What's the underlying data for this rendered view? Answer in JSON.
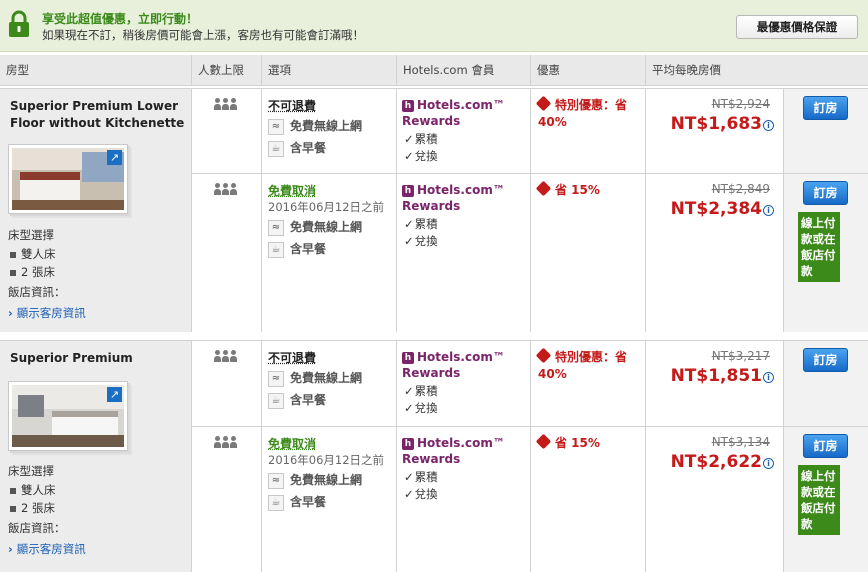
{
  "banner": {
    "title": "享受此超值優惠，立即行動！",
    "subtitle": "如果現在不訂，稍後房價可能會上漲，客房也有可能會訂滿哦！",
    "guarantee_label": "最優惠價格保證"
  },
  "table_headers": [
    "房型",
    "人數上限",
    "選項",
    "Hotels.com 會員",
    "優惠",
    "平均每晚房價"
  ],
  "labels": {
    "bed_choice": "床型選擇",
    "hotel_info": "飯店資訊：",
    "show_room_info": "顯示客房資訊",
    "book": "訂房",
    "pay_note": "線上付款或在飯店付款",
    "rewards_brand": "Hotels.com™ Rewards",
    "collect": "累積",
    "redeem": "兌換",
    "wifi": "免費無線上網",
    "breakfast": "含早餐"
  },
  "rooms": [
    {
      "name": "Superior Premium Lower Floor without Kitchenette",
      "beds": [
        "雙人床",
        "2 張床"
      ],
      "rates": [
        {
          "option": "不可退費",
          "option_date": "",
          "deal": "特別優惠：省 40%",
          "old_price": "NT$2,924",
          "price": "NT$1,683",
          "pay_note": false
        },
        {
          "option": "免費取消",
          "option_date": "2016年06月12日之前",
          "deal": "省 15%",
          "old_price": "NT$2,849",
          "price": "NT$2,384",
          "pay_note": true
        }
      ]
    },
    {
      "name": "Superior Premium",
      "beds": [
        "雙人床",
        "2 張床"
      ],
      "rates": [
        {
          "option": "不可退費",
          "option_date": "",
          "deal": "特別優惠：省 40%",
          "old_price": "NT$3,217",
          "price": "NT$1,851",
          "pay_note": false
        },
        {
          "option": "免費取消",
          "option_date": "2016年06月12日之前",
          "deal": "省 15%",
          "old_price": "NT$3,134",
          "price": "NT$2,622",
          "pay_note": true
        }
      ]
    }
  ],
  "colors": {
    "accent_green": "#3b8a1a",
    "price_red": "#c41a1a",
    "rewards_purple": "#7b2469",
    "link_blue": "#1a5fb4"
  },
  "icons": [
    "lock-icon",
    "zoom-icon",
    "people-icon",
    "wifi-icon",
    "breakfast-icon",
    "rewards-logo-icon",
    "check-icon",
    "tag-icon",
    "info-icon",
    "chevron-right-icon"
  ]
}
